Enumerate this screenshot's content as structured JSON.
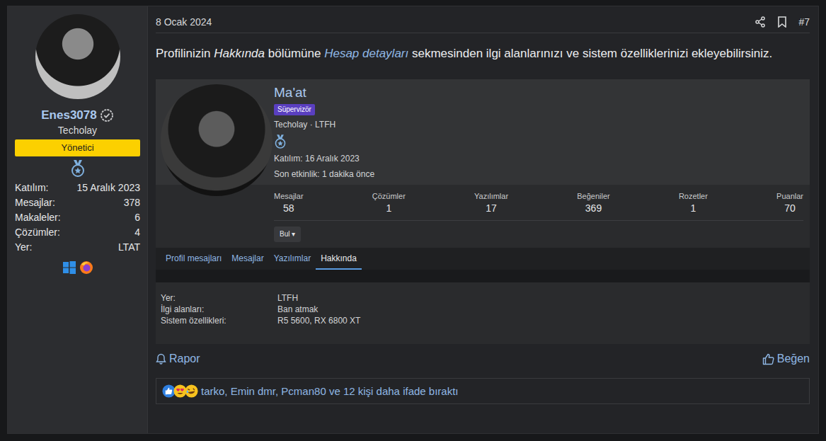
{
  "author": {
    "name": "Enes3078",
    "verified": true,
    "title": "Techolay",
    "role": "Yönetici",
    "stats": [
      {
        "label": "Katılım:",
        "value": "15 Aralık 2023"
      },
      {
        "label": "Mesajlar:",
        "value": "378"
      },
      {
        "label": "Makaleler:",
        "value": "6"
      },
      {
        "label": "Çözümler:",
        "value": "4"
      },
      {
        "label": "Yer:",
        "value": "LTAT"
      }
    ]
  },
  "post": {
    "date": "8 Ocak 2024",
    "number": "#7",
    "body": [
      {
        "text": "Profilinizin ",
        "kind": "plain"
      },
      {
        "text": "Hakkında",
        "kind": "em"
      },
      {
        "text": " bölümüne ",
        "kind": "plain"
      },
      {
        "text": "Hesap detayları",
        "kind": "link"
      },
      {
        "text": " sekmesinden ilgi alanlarınızı ve sistem özelliklerinizi ekleyebilirsiniz.",
        "kind": "plain"
      }
    ]
  },
  "screenshot": {
    "name": "Ma'at",
    "role": "Süpervizör",
    "subtitle": "Techolay · LTFH",
    "joined": "Katılım: 16 Aralık 2023",
    "last_seen": "Son etkinlik: 1 dakika önce",
    "stats": [
      {
        "label": "Mesajlar",
        "value": "58"
      },
      {
        "label": "Çözümler",
        "value": "1"
      },
      {
        "label": "Yazılımlar",
        "value": "17"
      },
      {
        "label": "Beğeniler",
        "value": "369"
      },
      {
        "label": "Rozetler",
        "value": "1"
      },
      {
        "label": "Puanlar",
        "value": "70"
      }
    ],
    "find_button": "Bul",
    "find_caret": "▾",
    "tabs": [
      {
        "label": "Profil mesajları",
        "selected": false
      },
      {
        "label": "Mesajlar",
        "selected": false
      },
      {
        "label": "Yazılımlar",
        "selected": false
      },
      {
        "label": "Hakkında",
        "selected": true
      }
    ],
    "about": [
      {
        "label": "Yer:",
        "value": "LTFH"
      },
      {
        "label": "İlgi alanları:",
        "value": "Ban atmak"
      },
      {
        "label": "Sistem özellikleri:",
        "value": "R5 5600, RX 6800 XT"
      }
    ]
  },
  "actions": {
    "report": "Rapor",
    "like": "Beğen"
  },
  "reactions": {
    "text": "tarko, Emin dmr, Pcman80 ve 12 kişi daha ifade bıraktı"
  }
}
